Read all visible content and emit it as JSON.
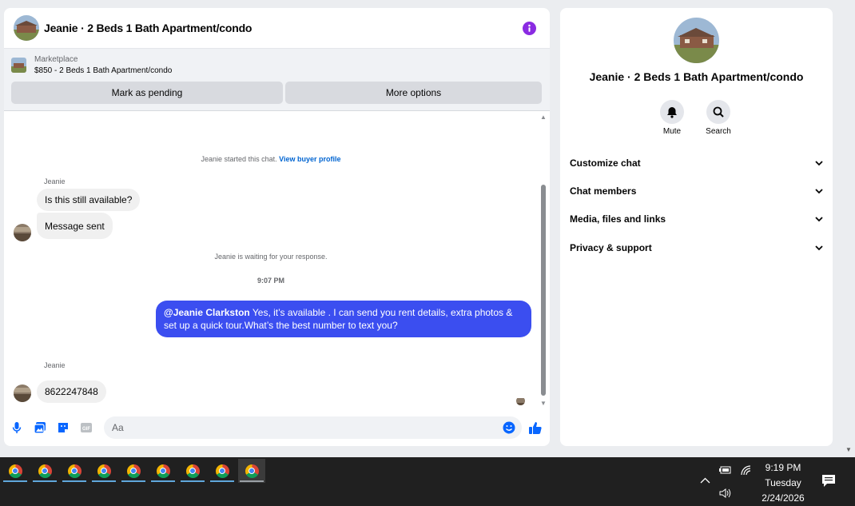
{
  "chat": {
    "title": "Jeanie · 2 Beds 1 Bath Apartment/condo",
    "listing": {
      "source": "Marketplace",
      "summary": "$850 - 2 Beds 1 Bath Apartment/condo"
    },
    "buttons": {
      "pending": "Mark as pending",
      "more": "More options"
    },
    "system": {
      "started_prefix": "Jeanie started this chat.",
      "buyer_profile_link": "View buyer profile",
      "waiting": "Jeanie is waiting for your response."
    },
    "messages": {
      "sender1": "Jeanie",
      "msg1": "Is this still available?",
      "msg2": "Message sent",
      "time": "9:07 PM",
      "out_mention": "@Jeanie Clarkston",
      "out_text": " Yes, it’s available .  I can send you rent details, extra photos & set up a quick tour.What’s the best number to text you?",
      "sender2": "Jeanie",
      "msg3": "8622247848"
    },
    "composer": {
      "placeholder": "Aa"
    }
  },
  "info_panel": {
    "title": "Jeanie · 2 Beds 1 Bath Apartment/condo",
    "actions": {
      "mute": "Mute",
      "search": "Search"
    },
    "sections": [
      "Customize chat",
      "Chat members",
      "Media, files and links",
      "Privacy & support"
    ]
  },
  "taskbar": {
    "time": "9:19 PM",
    "day": "Tuesday",
    "date": "2/24/2026"
  },
  "colors": {
    "accent": "#3b4ef0",
    "link": "#0064d1",
    "info": "#8a2be2"
  }
}
